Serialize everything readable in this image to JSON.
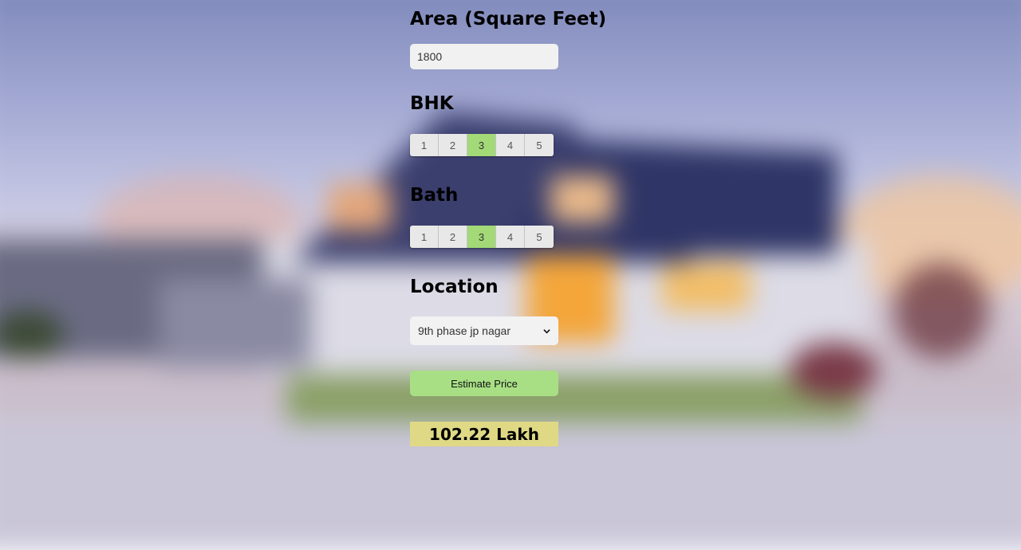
{
  "area": {
    "label": "Area (Square Feet)",
    "value": "1800"
  },
  "bhk": {
    "label": "BHK",
    "options": [
      "1",
      "2",
      "3",
      "4",
      "5"
    ],
    "selected": "3"
  },
  "bath": {
    "label": "Bath",
    "options": [
      "1",
      "2",
      "3",
      "4",
      "5"
    ],
    "selected": "3"
  },
  "location": {
    "label": "Location",
    "selected": "9th phase jp nagar"
  },
  "estimate_button": {
    "label": "Estimate Price"
  },
  "result": {
    "text": "102.22 Lakh"
  },
  "colors": {
    "selected_segment": "#a3d977",
    "button": "#a8df85",
    "result_bg": "#dfd986"
  },
  "icons": {
    "select_arrow": "chevron-down-icon"
  }
}
